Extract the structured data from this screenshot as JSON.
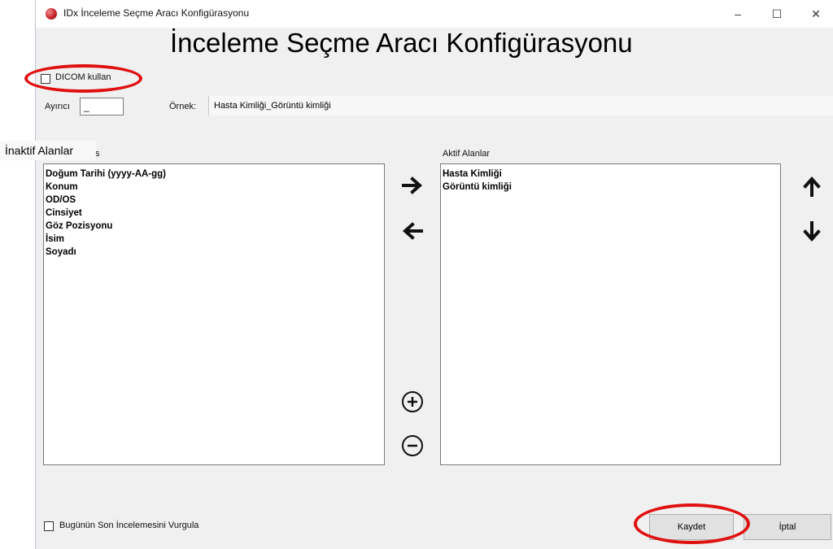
{
  "window": {
    "title": "IDx İnceleme Seçme Aracı Konfigürasyonu",
    "minimize": "–",
    "maximize": "☐",
    "close": "✕"
  },
  "heading": "İnceleme Seçme Aracı Konfigürasyonu",
  "dicom": {
    "label": "DICOM kullan",
    "checked": false
  },
  "separator": {
    "label": "Ayırıcı",
    "value": "_"
  },
  "example": {
    "label": "Örnek:",
    "value": "Hasta Kimliği_Görüntü kimliği"
  },
  "inactive": {
    "header_overlay": "İnaktif Alanlar",
    "header_fragment": "ıs",
    "items": [
      "Doğum Tarihi (yyyy-AA-gg)",
      "Konum",
      "OD/OS",
      "Cinsiyet",
      "Göz Pozisyonu",
      "İsim",
      "Soyadı"
    ]
  },
  "active": {
    "header": "Aktif Alanlar",
    "items": [
      "Hasta Kimliği",
      "Görüntü kimliği"
    ]
  },
  "highlight_today": {
    "label": "Bugünün Son İncelemesini Vurgula",
    "checked": false
  },
  "buttons": {
    "save": "Kaydet",
    "cancel": "İptal"
  },
  "icons": {
    "move_right": "arrow-right-icon",
    "move_left": "arrow-left-icon",
    "move_up": "arrow-up-icon",
    "move_down": "arrow-down-icon",
    "add": "plus-circle-icon",
    "remove": "minus-circle-icon"
  },
  "colors": {
    "annotation_red": "#e01010",
    "app_icon": "#c8262a"
  }
}
